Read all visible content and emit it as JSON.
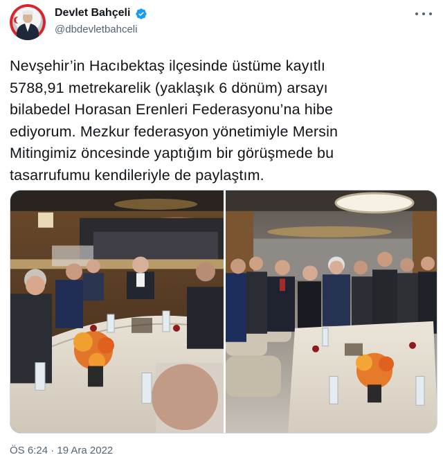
{
  "author": {
    "display_name": "Devlet Bahçeli",
    "handle": "@dbdevletbahceli",
    "verified": true,
    "avatar_icon": "profile-photo"
  },
  "tweet": {
    "lines": [
      "Nevşehir’in Hacıbektaş ilçesinde üstüme kayıtlı",
      "5788,91 metrekarelik (yaklaşık 6 dönüm) arsayı",
      "bilabedel Horasan Erenleri Federasyonu’na hibe",
      "ediyorum. Mezkur federasyon yönetimiyle Mersin",
      "Mitingimiz öncesinde yaptığım bir görüşmede bu",
      "tasarrufumu kendileriyle de paylaştım."
    ],
    "media": {
      "count": 2,
      "photos": [
        "meeting-table-photo",
        "group-standing-photo"
      ]
    },
    "timestamp": "ÖS 6:24 · 19 Ara 2022"
  },
  "colors": {
    "text_primary": "#0f1419",
    "text_secondary": "#536471",
    "verified_blue": "#1d9bf0",
    "border": "#cfd9de",
    "avatar_red": "#d7262b"
  }
}
